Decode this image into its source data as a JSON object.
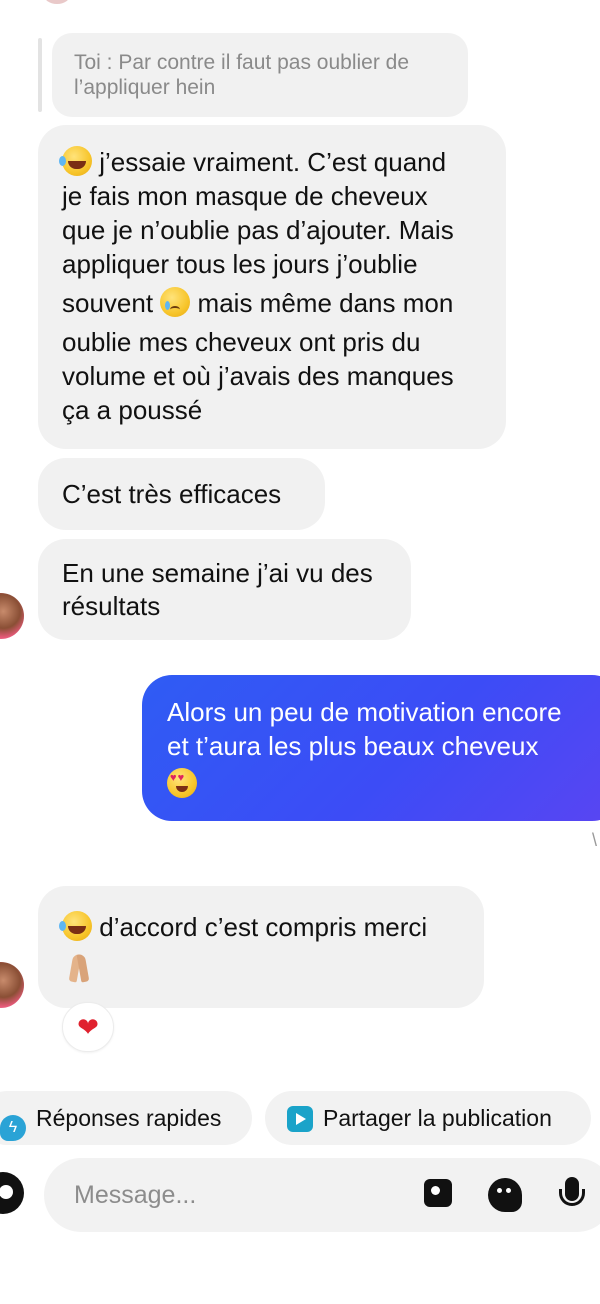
{
  "reply_preview": {
    "text_line1": "Toi : Par contre il faut pas oublier de",
    "text_line2": "l’appliquer hein"
  },
  "messages": {
    "m1": {
      "line1": "j’essaie vraiment. C’est quand",
      "line2": "je fais mon masque de cheveux",
      "line3": "que je n’oublie pas d’ajouter. Mais",
      "line4": "appliquer tous les jours j’oublie",
      "line5a": "souvent",
      "line5b": "mais même dans mon",
      "line6": "oublie mes cheveux ont pris du",
      "line7": "volume et où j’avais des manques",
      "line8": "ça a poussé"
    },
    "m2": {
      "text": "C’est très efficaces"
    },
    "m3": {
      "line1": "En une semaine j’ai vu des",
      "line2": "résultats"
    },
    "m4": {
      "line1": "Alors un peu de motivation encore",
      "line2": "et t’aura les plus beaux cheveux"
    },
    "m5": {
      "line1": "d’accord c’est compris merci"
    }
  },
  "seen_mark": "\\",
  "reaction": {
    "emoji": "❤"
  },
  "quick_actions": {
    "chip1_label": "Réponses rapides",
    "chip2_label": "Partager la publication"
  },
  "composer": {
    "placeholder": "Message..."
  },
  "colors": {
    "outgoing_gradient_start": "#2f5cf4",
    "outgoing_gradient_end": "#5a45f2",
    "incoming_bubble": "#f1f1f1"
  }
}
